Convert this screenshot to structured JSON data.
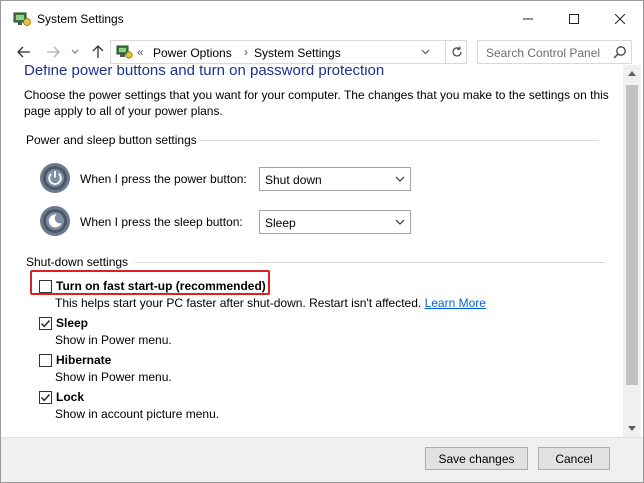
{
  "window": {
    "title": "System Settings",
    "app_icon": "power-options-icon"
  },
  "navigation": {
    "back_icon": "arrow-left-icon",
    "forward_icon": "arrow-right-icon",
    "recent_icon": "chevron-down-icon",
    "up_icon": "arrow-up-icon",
    "address_prefix": "«",
    "breadcrumb": [
      "Power Options",
      "System Settings"
    ],
    "breadcrumb_separator": "›",
    "refresh_icon": "refresh-icon",
    "search_placeholder": "Search Control Panel"
  },
  "page": {
    "title": "Define power buttons and turn on password protection",
    "intro": "Choose the power settings that you want for your computer. The changes that you make to the settings on this page apply to all of your power plans."
  },
  "power_section": {
    "label": "Power and sleep button settings",
    "rows": [
      {
        "label": "When I press the power button:",
        "value": "Shut down",
        "icon": "power-button-icon"
      },
      {
        "label": "When I press the sleep button:",
        "value": "Sleep",
        "icon": "sleep-button-icon"
      }
    ]
  },
  "shutdown_section": {
    "label": "Shut-down settings",
    "options": [
      {
        "label": "Turn on fast start-up (recommended)",
        "checked": false,
        "desc": "This helps start your PC faster after shut-down. Restart isn't affected.",
        "link": "Learn More"
      },
      {
        "label": "Sleep",
        "checked": true,
        "desc": "Show in Power menu."
      },
      {
        "label": "Hibernate",
        "checked": false,
        "desc": "Show in Power menu."
      },
      {
        "label": "Lock",
        "checked": true,
        "desc": "Show in account picture menu."
      }
    ]
  },
  "footer": {
    "save_label": "Save changes",
    "cancel_label": "Cancel"
  },
  "colors": {
    "title_blue": "#1e3287",
    "link_blue": "#0066cc",
    "highlight_red": "#e02020"
  }
}
